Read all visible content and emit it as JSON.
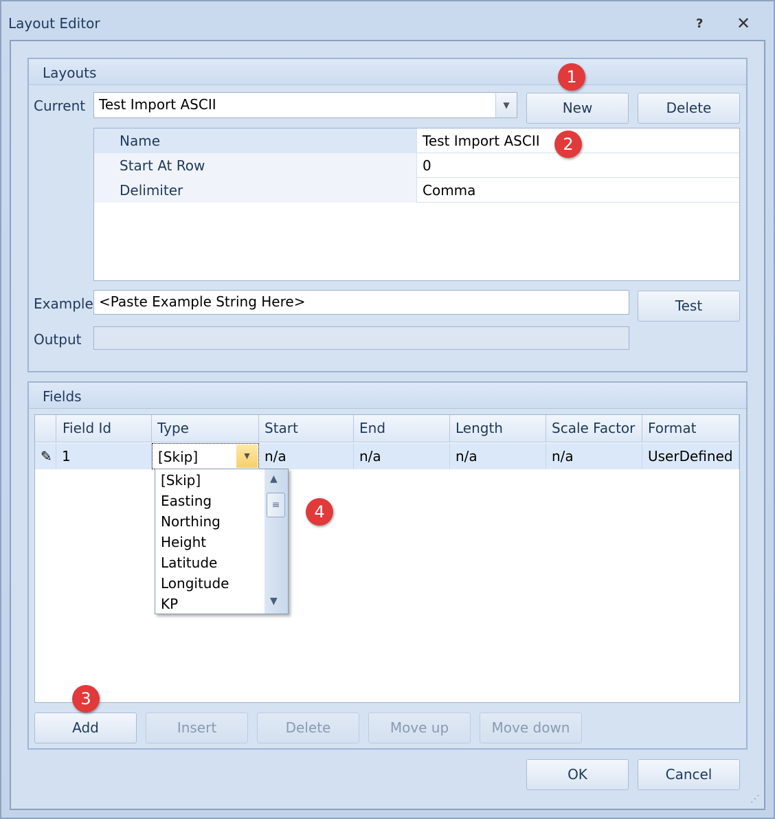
{
  "window": {
    "title": "Layout Editor",
    "help_icon": "help-icon",
    "close_icon": "close-icon"
  },
  "layouts": {
    "group_title": "Layouts",
    "current_label": "Current",
    "current_value": "Test Import ASCII",
    "new_label": "New",
    "delete_label": "Delete",
    "properties": [
      {
        "name": "Name",
        "value": "Test Import ASCII"
      },
      {
        "name": "Start At Row",
        "value": "0"
      },
      {
        "name": "Delimiter",
        "value": "Comma"
      }
    ],
    "example_label": "Example",
    "example_value": "<Paste Example String Here>",
    "test_label": "Test",
    "output_label": "Output",
    "output_value": ""
  },
  "fields": {
    "group_title": "Fields",
    "columns": [
      "Field Id",
      "Type",
      "Start",
      "End",
      "Length",
      "Scale Factor",
      "Format"
    ],
    "rows": [
      {
        "field_id": "1",
        "type": "[Skip]",
        "start": "n/a",
        "end": "n/a",
        "length": "n/a",
        "scale_factor": "n/a",
        "format": "UserDefined"
      }
    ],
    "type_options": [
      "[Skip]",
      "Easting",
      "Northing",
      "Height",
      "Latitude",
      "Longitude",
      "KP"
    ],
    "buttons": {
      "add": "Add",
      "insert": "Insert",
      "delete": "Delete",
      "move_up": "Move up",
      "move_down": "Move down"
    }
  },
  "footer": {
    "ok": "OK",
    "cancel": "Cancel"
  },
  "badges": [
    "1",
    "2",
    "3",
    "4"
  ],
  "colors": {
    "badge": "#e03a3a",
    "accent": "#1e395b",
    "selected_row": "#dbe8f9"
  }
}
